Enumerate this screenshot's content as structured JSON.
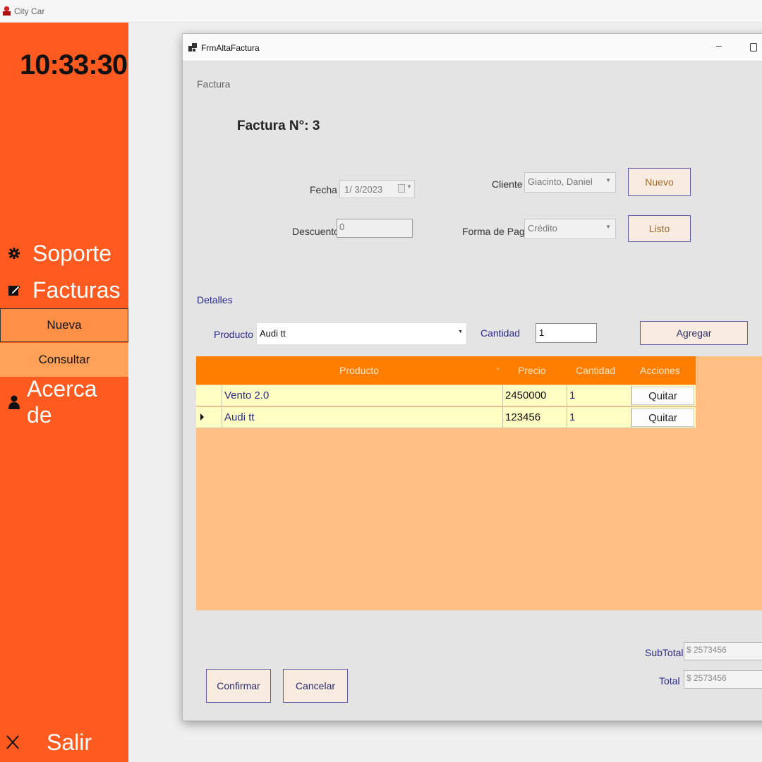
{
  "app": {
    "title": "City Car"
  },
  "sidebar": {
    "clock": "10:33:30",
    "items": [
      {
        "label": "Soporte"
      },
      {
        "label": "Facturas"
      },
      {
        "label": "Acerca de"
      },
      {
        "label": "Salir"
      }
    ],
    "sub_items": [
      {
        "label": "Nueva"
      },
      {
        "label": "Consultar"
      }
    ]
  },
  "window": {
    "title": "FrmAltaFactura",
    "minimize_symbol": "–"
  },
  "form": {
    "group_label": "Factura",
    "factura_number": "Factura N°: 3",
    "fecha_label": "Fecha",
    "fecha_value": "1/ 3/2023",
    "descuento_label": "Descuento",
    "descuento_value": "0",
    "cliente_label": "Cliente",
    "cliente_value": "Giacinto, Daniel",
    "forma_pago_label": "Forma de Pago",
    "forma_pago_value": "Crédito",
    "nuevo_button": "Nuevo",
    "listo_button": "Listo",
    "detalles_label": "Detalles",
    "producto_label": "Producto",
    "producto_value": "Audi tt",
    "cantidad_label": "Cantidad",
    "cantidad_value": "1",
    "agregar_button": "Agregar"
  },
  "grid": {
    "columns": [
      "Producto",
      "Precio",
      "Cantidad",
      "Acciones"
    ],
    "rows": [
      {
        "producto": "Vento 2.0",
        "precio": "2450000",
        "cantidad": "1",
        "accion": "Quitar"
      },
      {
        "producto": "Audi tt",
        "precio": "123456",
        "cantidad": "1",
        "accion": "Quitar"
      }
    ]
  },
  "totals": {
    "subtotal_label": "SubTotal",
    "subtotal_value": "$ 2573456",
    "total_label": "Total",
    "total_value": "$ 2573456"
  },
  "actions": {
    "confirmar": "Confirmar",
    "cancelar": "Cancelar"
  },
  "colors": {
    "sidebar": "#ff5a1f",
    "grid_header": "#ff7e00",
    "grid_bg": "#ffbf82",
    "row_bg": "#ffffc4"
  }
}
